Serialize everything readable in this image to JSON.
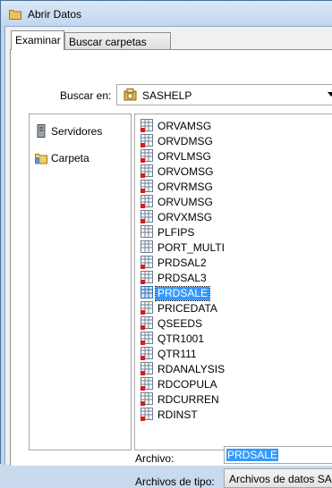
{
  "window": {
    "title": "Abrir Datos"
  },
  "tabs": [
    {
      "label": "Examinar",
      "active": true
    },
    {
      "label": "Buscar carpetas SAS",
      "active": false
    }
  ],
  "lookin": {
    "label": "Buscar en:",
    "value": "SASHELP"
  },
  "places": [
    {
      "label": "Servidores",
      "icon": "server-icon"
    },
    {
      "label": "Carpeta",
      "icon": "folder-icon"
    }
  ],
  "files": [
    {
      "name": "ORVAMSG"
    },
    {
      "name": "ORVDMSG"
    },
    {
      "name": "ORVLMSG"
    },
    {
      "name": "ORVOMSG"
    },
    {
      "name": "ORVRMSG"
    },
    {
      "name": "ORVUMSG"
    },
    {
      "name": "ORVXMSG"
    },
    {
      "name": "PLFIPS"
    },
    {
      "name": "PORT_MULTI"
    },
    {
      "name": "PRDSAL2"
    },
    {
      "name": "PRDSAL3"
    },
    {
      "name": "PRDSALE",
      "selected": true
    },
    {
      "name": "PRICEDATA"
    },
    {
      "name": "QSEEDS"
    },
    {
      "name": "QTR1001"
    },
    {
      "name": "QTR111"
    },
    {
      "name": "RDANALYSIS"
    },
    {
      "name": "RDCOPULA"
    },
    {
      "name": "RDCURREN"
    },
    {
      "name": "RDINST"
    }
  ],
  "filename": {
    "label": "Archivo:",
    "value": "PRDSALE"
  },
  "filetype": {
    "label": "Archivos de tipo:",
    "value": "Archivos de datos SAS"
  },
  "colors": {
    "selection": "#3399ff",
    "titlebar": "#c3d6ee"
  }
}
